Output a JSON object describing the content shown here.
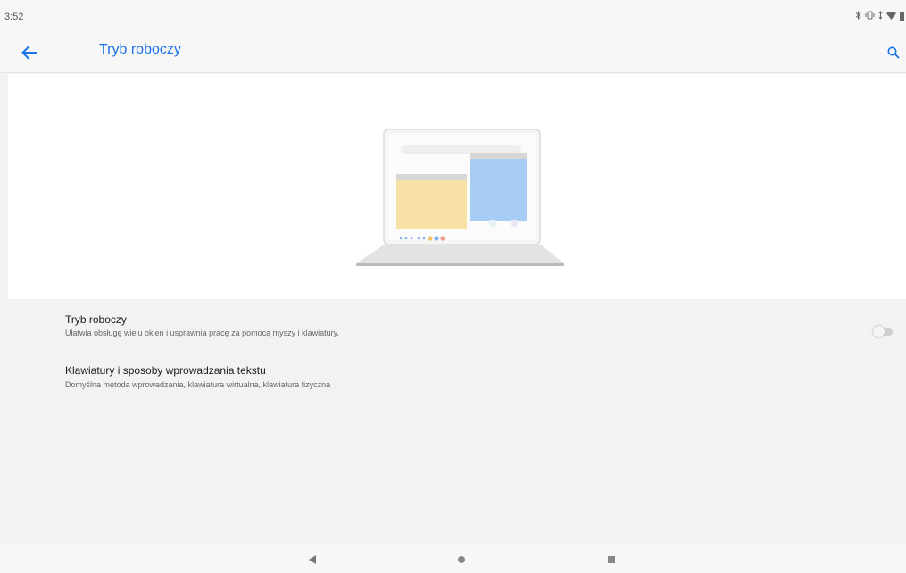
{
  "status_bar": {
    "time": "3:52",
    "icons": [
      "bluetooth-icon",
      "vibrate-icon",
      "data-arrows-icon",
      "wifi-icon",
      "battery-icon"
    ]
  },
  "app_bar": {
    "title": "Tryb roboczy",
    "back_icon": "arrow-left-icon",
    "search_icon": "search-icon",
    "accent": "#1a73e8"
  },
  "settings": [
    {
      "title": "Tryb roboczy",
      "subtitle": "Ułatwia obsługę wielu okien i usprawnia pracę za pomocą myszy i klawiatury.",
      "toggle": false
    },
    {
      "title": "Klawiatury i sposoby wprowadzania tekstu",
      "subtitle": "Domyślna metoda wprowadzania, klawiatura wirtualna, klawiatura fizyczna"
    }
  ],
  "nav_bar": {
    "buttons": [
      "back-triangle-icon",
      "home-circle-icon",
      "recents-square-icon"
    ]
  }
}
